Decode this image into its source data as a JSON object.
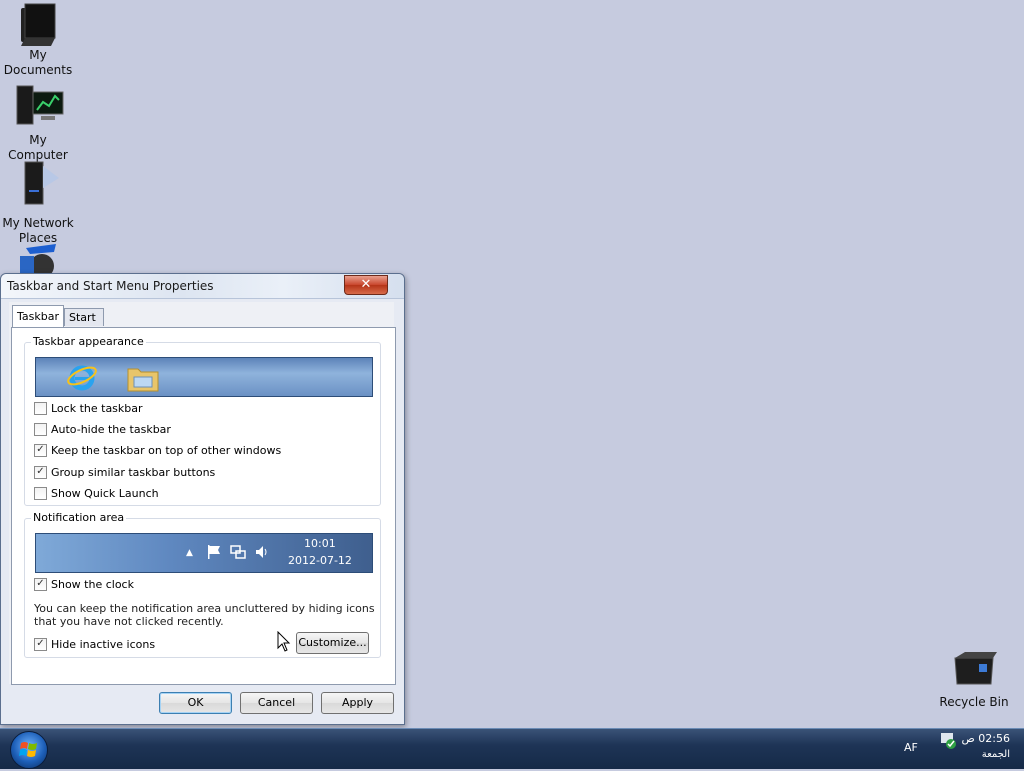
{
  "desktop": {
    "icons": [
      {
        "label": "My\nDocuments"
      },
      {
        "label": "My Computer"
      },
      {
        "label": "My Network\nPlaces"
      },
      {
        "label": "Recycle Bin"
      }
    ]
  },
  "window": {
    "title": "Taskbar and Start Menu Properties",
    "close_label": "✕",
    "tabs": [
      {
        "label": "Taskbar"
      },
      {
        "label": "Start Menu"
      }
    ],
    "appearance": {
      "label": "Taskbar appearance",
      "options": [
        {
          "label": "Lock the taskbar",
          "checked": false
        },
        {
          "label": "Auto-hide the taskbar",
          "checked": false
        },
        {
          "label": "Keep the taskbar on top of other windows",
          "checked": true
        },
        {
          "label": "Group similar taskbar buttons",
          "checked": true
        },
        {
          "label": "Show Quick Launch",
          "checked": false
        }
      ]
    },
    "notification": {
      "label": "Notification area",
      "preview_time": "10:01",
      "preview_date": "2012-07-12",
      "show_clock": {
        "label": "Show the clock",
        "checked": true
      },
      "info": "You can keep the notification area uncluttered by hiding icons that you have not clicked recently.",
      "hide_inactive": {
        "label": "Hide inactive icons",
        "checked": true
      },
      "customize_label": "Customize..."
    },
    "buttons": {
      "ok": "OK",
      "cancel": "Cancel",
      "apply": "Apply"
    }
  },
  "taskbar": {
    "language": "AF",
    "time": "02:56 ص",
    "day": "الجمعة"
  },
  "icons": [
    "documents-icon",
    "computer-icon",
    "network-icon",
    "recycle-bin-icon",
    "ie-icon",
    "folder-icon",
    "flag-icon",
    "network-tray-icon",
    "volume-icon",
    "start-orb-icon"
  ]
}
